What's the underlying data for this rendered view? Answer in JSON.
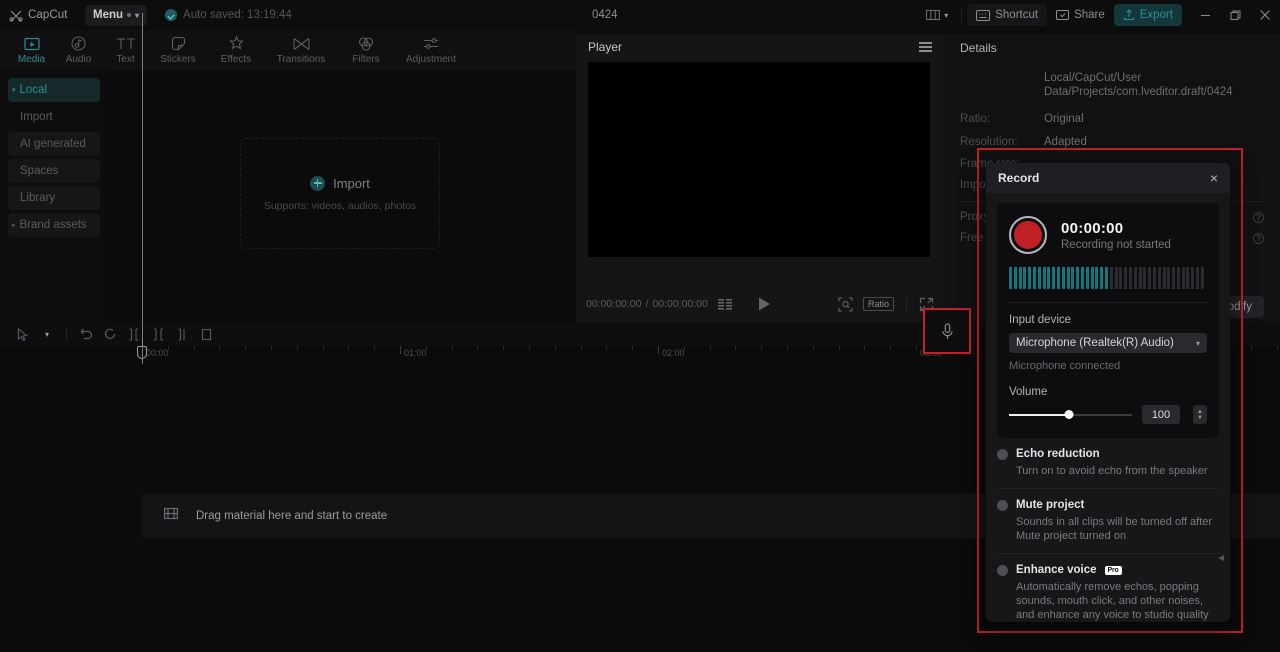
{
  "titlebar": {
    "brand": "CapCut",
    "menu_label": "Menu",
    "autosave": "Auto saved: 13:19:44",
    "project_title": "0424",
    "shortcut_label": "Shortcut",
    "share_label": "Share",
    "export_label": "Export",
    "minimize": "–",
    "maximize": "❐",
    "close": "×"
  },
  "tabs": [
    {
      "label": "Media",
      "icon": "media-icon",
      "active": true
    },
    {
      "label": "Audio",
      "icon": "audio-icon",
      "active": false
    },
    {
      "label": "Text",
      "icon": "text-icon",
      "active": false
    },
    {
      "label": "Stickers",
      "icon": "stickers-icon",
      "active": false
    },
    {
      "label": "Effects",
      "icon": "effects-icon",
      "active": false
    },
    {
      "label": "Transitions",
      "icon": "transitions-icon",
      "active": false
    },
    {
      "label": "Filters",
      "icon": "filters-icon",
      "active": false
    },
    {
      "label": "Adjustment",
      "icon": "adjustment-icon",
      "active": false
    }
  ],
  "sidebar": {
    "items": [
      {
        "label": "Local",
        "active": true,
        "caret": "▾"
      },
      {
        "label": "Import",
        "active": false
      },
      {
        "label": "AI generated",
        "active": false
      },
      {
        "label": "Spaces",
        "active": false
      },
      {
        "label": "Library",
        "active": false
      },
      {
        "label": "Brand assets",
        "active": false,
        "caret": "▸"
      }
    ]
  },
  "media": {
    "import_label": "Import",
    "import_hint": "Supports: videos, audios, photos"
  },
  "player": {
    "title": "Player",
    "current_time": "00:00:00:00",
    "total_time": "00:00:00:00",
    "time_separator": "/",
    "ratio_label": "Ratio"
  },
  "details": {
    "title": "Details",
    "path_value": "Local/CapCut/User Data/Projects/com.lveditor.draft/0424",
    "rows": [
      {
        "key": "Ratio:",
        "value": "Original"
      },
      {
        "key": "Resolution:",
        "value": "Adapted"
      },
      {
        "key": "Frame rate:",
        "value": ""
      },
      {
        "key": "Import:",
        "value": ""
      }
    ],
    "rows2": [
      {
        "key": "Proxy:",
        "value": ""
      },
      {
        "key": "Free la",
        "value": ""
      }
    ],
    "modify_label": "Modify",
    "help_glyph": "?"
  },
  "timeline": {
    "ruler_labels": [
      "00:00",
      "01:00",
      "02:00",
      "03:00"
    ],
    "drop_text": "Drag material here and start to create"
  },
  "record": {
    "title": "Record",
    "close_glyph": "×",
    "time": "00:00:00",
    "status": "Recording not started",
    "meter_total": 41,
    "meter_filled": 21,
    "input_device_label": "Input device",
    "input_device_value": "Microphone (Realtek(R) Audio)",
    "device_hint": "Microphone connected",
    "volume_label": "Volume",
    "volume_value": "100",
    "options": [
      {
        "title": "Echo reduction",
        "desc": "Turn on to avoid echo from the speaker",
        "enabled": false,
        "badge": ""
      },
      {
        "title": "Mute project",
        "desc": "Sounds in all clips will be turned off after Mute project turned on",
        "enabled": false,
        "badge": ""
      },
      {
        "title": "Enhance voice",
        "desc": "Automatically remove echos, popping sounds, mouth click, and other noises, and enhance any voice to studio quality",
        "enabled": false,
        "badge": "Pro"
      }
    ]
  },
  "colors": {
    "accent": "#2f8e92",
    "record_red": "#c02126",
    "highlight_red": "#c0202a",
    "meter_teal": "#13757d"
  }
}
